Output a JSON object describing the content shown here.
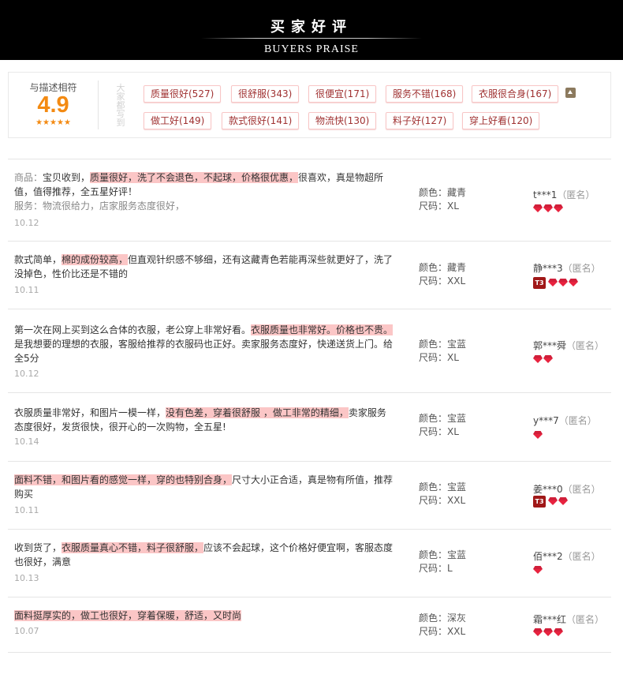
{
  "header": {
    "title": "买家好评",
    "subtitle": "BUYERS PRAISE"
  },
  "rating": {
    "label": "与描述相符",
    "score": "4.9",
    "stars": "★★★★★"
  },
  "tag_section": {
    "side_label": "大家都写到",
    "tags": [
      "质量很好(527)",
      "很舒服(343)",
      "很便宜(171)",
      "服务不错(168)",
      "衣服很合身(167)",
      "做工好(149)",
      "款式很好(141)",
      "物流快(130)",
      "料子好(127)",
      "穿上好看(120)"
    ],
    "collapse_icon": "chevron-up-icon"
  },
  "colors": {
    "header_bg": "#000000",
    "score": "#f38a12",
    "highlight": "#fbc6c6",
    "tag_border": "#f8c6c6",
    "tag_text": "#a03232",
    "gem": "#e8233f",
    "level_badge": "#a01818"
  },
  "reviews": [
    {
      "segments": [
        {
          "text": "商品：",
          "style": "prefix"
        },
        {
          "text": "宝贝收到，",
          "style": "normal"
        },
        {
          "text": "质量很好，洗了不会退色，不起球，价格很优惠，",
          "style": "highlight"
        },
        {
          "text": "很喜欢，真是物超所值，值得推荐，全五星好评！",
          "style": "normal"
        },
        {
          "text": "\n",
          "style": "break"
        },
        {
          "text": "服务：",
          "style": "prefix"
        },
        {
          "text": "物流很给力，店家服务态度很好，",
          "style": "prefix"
        }
      ],
      "date": "10.12",
      "color": "颜色：藏青",
      "size": "尺码：XL",
      "user": "t***1",
      "anon": "（匿名）",
      "level_badge": "",
      "gems": 3
    },
    {
      "segments": [
        {
          "text": "款式简单，",
          "style": "normal"
        },
        {
          "text": "棉的成份较高，",
          "style": "highlight"
        },
        {
          "text": "但直观针织感不够细，还有这藏青色若能再深些就更好了，洗了没掉色，性价比还是不错的",
          "style": "normal"
        }
      ],
      "date": "10.11",
      "color": "颜色：藏青",
      "size": "尺码：XXL",
      "user": "静***3",
      "anon": "（匿名）",
      "level_badge": "T3",
      "gems": 3
    },
    {
      "segments": [
        {
          "text": "第一次在网上买到这么合体的衣服，老公穿上非常好看。",
          "style": "normal"
        },
        {
          "text": "衣服质量也非常好。价格也不贵。",
          "style": "highlight"
        },
        {
          "text": "是我想要的理想的衣服，客服给推荐的衣服码也正好。卖家服务态度好，快递送货上门。给全5分",
          "style": "normal"
        }
      ],
      "date": "10.12",
      "color": "颜色：宝蓝",
      "size": "尺码：XL",
      "user": "郭***舜",
      "anon": "（匿名）",
      "level_badge": "",
      "gems": 2
    },
    {
      "segments": [
        {
          "text": "衣服质量非常好，和图片一模一样，",
          "style": "normal"
        },
        {
          "text": "没有色差，穿着很舒服 ，做工非常的精细，",
          "style": "highlight"
        },
        {
          "text": "卖家服务态度很好，发货很快，很开心的一次购物，全五星!",
          "style": "normal"
        }
      ],
      "date": "10.14",
      "color": "颜色：宝蓝",
      "size": "尺码：XL",
      "user": "y***7",
      "anon": "（匿名）",
      "level_badge": "",
      "gems": 1
    },
    {
      "segments": [
        {
          "text": "面料不错，和图片看的感觉一样，穿的也特别合身，",
          "style": "highlight"
        },
        {
          "text": "尺寸大小正合适，真是物有所值，推荐购买",
          "style": "normal"
        }
      ],
      "date": "10.11",
      "color": "颜色：宝蓝",
      "size": "尺码：XXL",
      "user": "姜***0",
      "anon": "（匿名）",
      "level_badge": "T3",
      "gems": 2
    },
    {
      "segments": [
        {
          "text": "收到货了，",
          "style": "normal"
        },
        {
          "text": "衣服质量真心不错，料子很舒服，",
          "style": "highlight"
        },
        {
          "text": "应该不会起球，这个价格好便宜啊，客服态度也很好，满意",
          "style": "normal"
        }
      ],
      "date": "10.13",
      "color": "颜色：宝蓝",
      "size": "尺码：L",
      "user": "佰***2",
      "anon": "（匿名）",
      "level_badge": "",
      "gems": 1
    },
    {
      "segments": [
        {
          "text": "面料挺厚实的，做工也很好，穿着保暖，舒适，又时尚",
          "style": "highlight"
        }
      ],
      "date": "10.07",
      "color": "颜色：深灰",
      "size": "尺码：XXL",
      "user": "霜***红",
      "anon": "（匿名）",
      "level_badge": "",
      "gems": 3
    }
  ]
}
